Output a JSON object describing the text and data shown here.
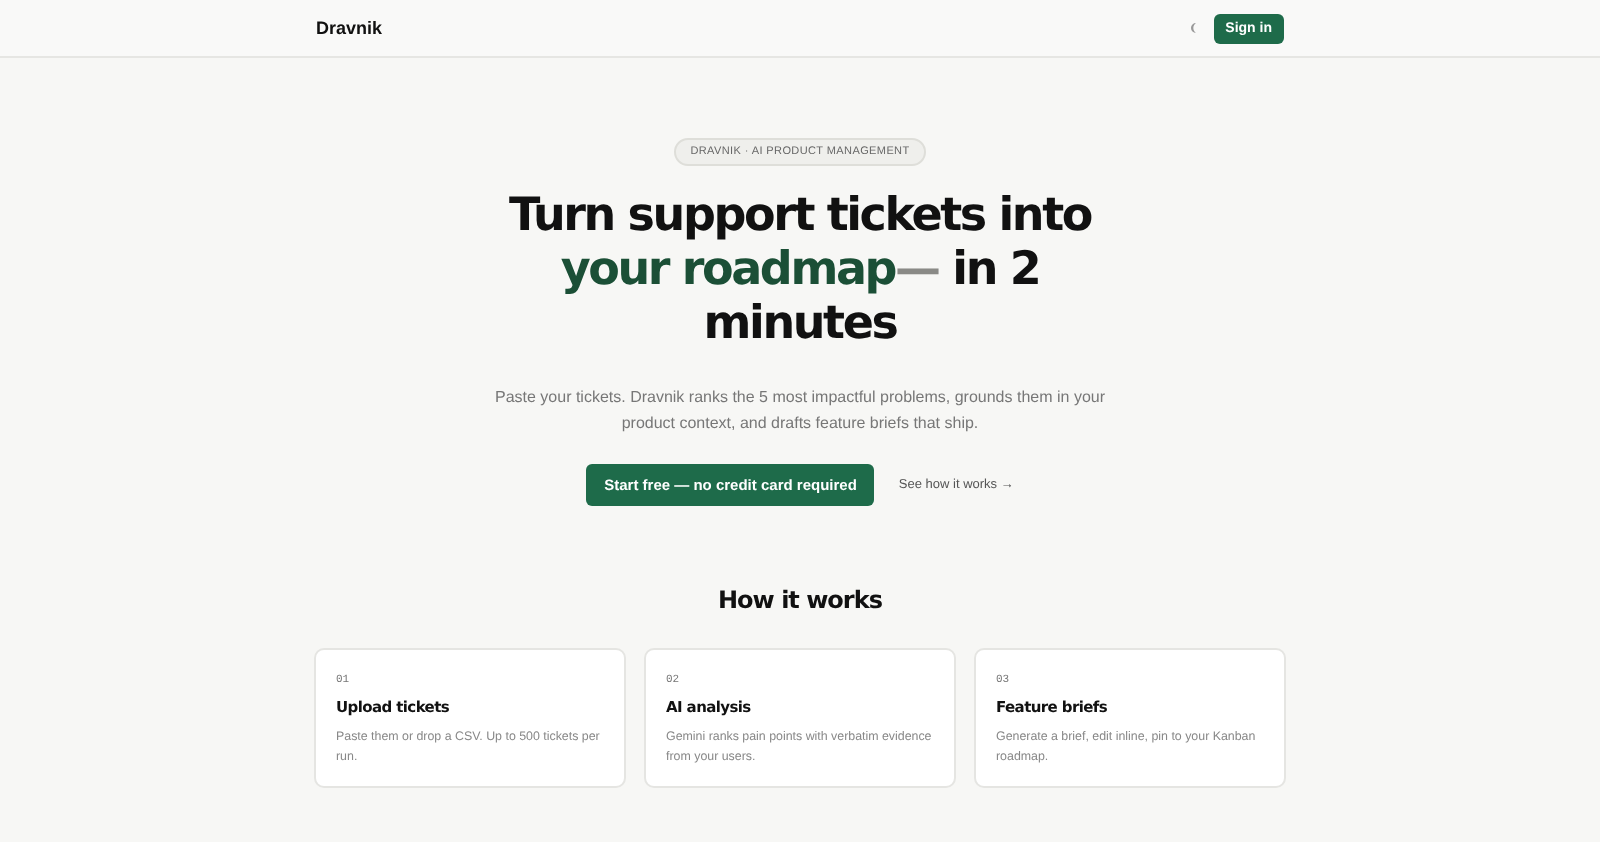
{
  "nav": {
    "brand": "Dravnik",
    "sign_in": "Sign in"
  },
  "hero": {
    "badge": "DRAVNIK · AI PRODUCT MANAGEMENT",
    "headline": {
      "lead": "Turn support tickets into",
      "accent": "your roadmap",
      "dash": "—",
      "tail": " in 2 minutes"
    },
    "subtitle": "Paste your tickets. Dravnik ranks the 5 most impactful problems, grounds them in your product context, and drafts feature briefs that ship.",
    "primary_button": "Start free — no credit card required",
    "secondary_link": "See how it works →"
  },
  "how_it_works": {
    "title": "How it works",
    "steps": [
      {
        "number": "01",
        "title": "Upload tickets",
        "description": "Paste them or drop a CSV. Up to 500 tickets per run."
      },
      {
        "number": "02",
        "title": "AI analysis",
        "description": "Gemini ranks pain points with verbatim evidence from your users."
      },
      {
        "number": "03",
        "title": "Feature briefs",
        "description": "Generate a brief, edit inline, pin to your Kanban roadmap."
      }
    ]
  }
}
